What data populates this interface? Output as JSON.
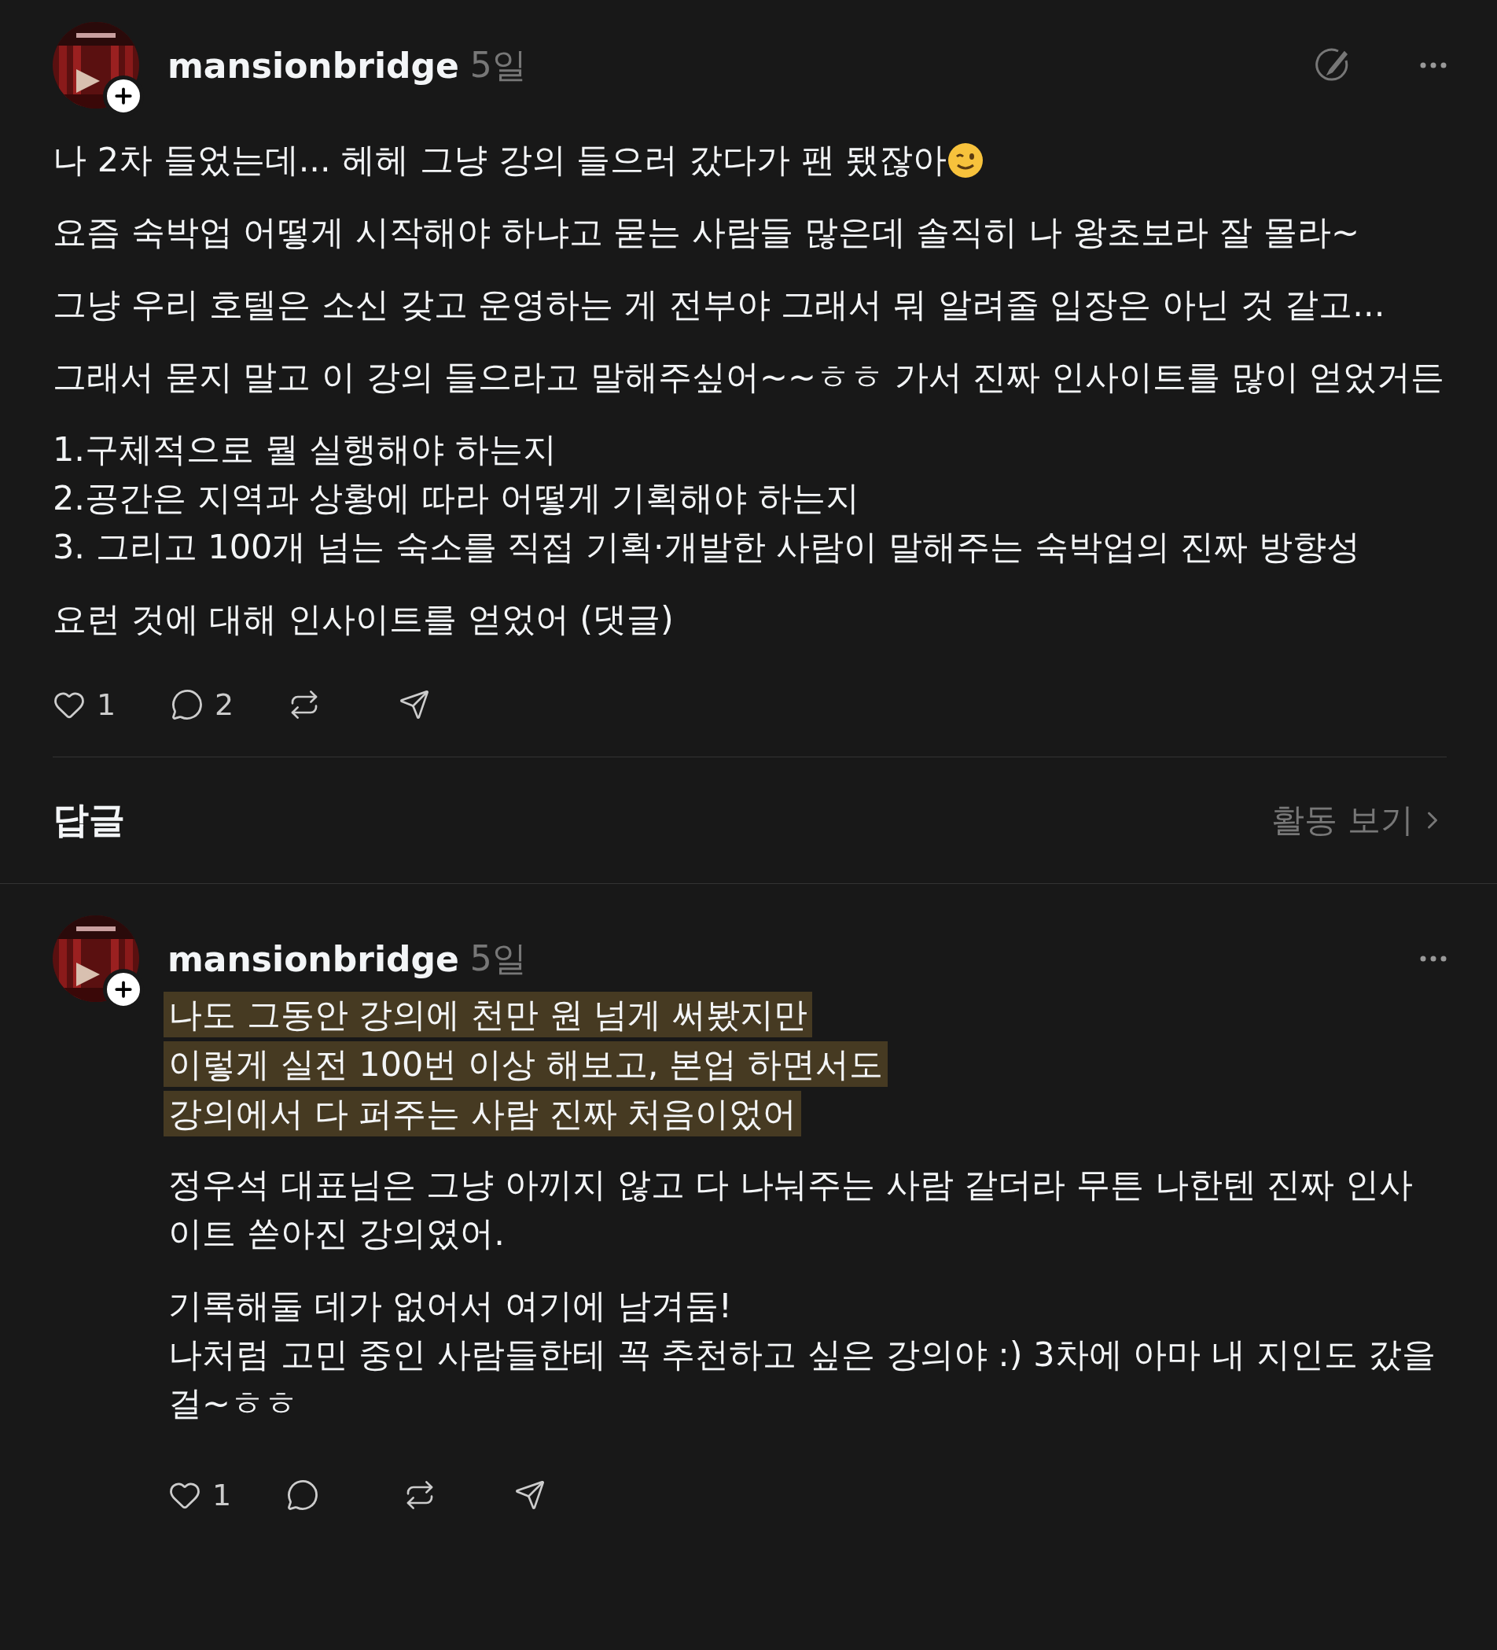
{
  "post": {
    "author": "mansionbridge",
    "time": "5일",
    "following": false,
    "paragraphs": [
      {
        "lines": [
          "나 2차 들었는데... 헤헤 그냥 강의 들으러 갔다가 팬 됐잖아"
        ],
        "emoji": true
      },
      {
        "lines": [
          "요즘 숙박업 어떻게 시작해야 하냐고 묻는 사람들 많은데 솔직히 나 왕초보라 잘 몰라~"
        ],
        "emoji": false
      },
      {
        "lines": [
          "그냥 우리 호텔은 소신 갖고 운영하는 게 전부야 그래서 뭐 알려줄 입장은 아닌 것 같고..."
        ],
        "emoji": false
      },
      {
        "lines": [
          "그래서 묻지 말고 이 강의 들으라고 말해주싶어~~ㅎㅎ 가서 진짜 인사이트를 많이 얻었거든"
        ],
        "emoji": false
      },
      {
        "lines": [
          "1.구체적으로 뭘 실행해야 하는지",
          "2.공간은 지역과 상황에 따라 어떻게 기획해야 하는지",
          "3. 그리고 100개 넘는 숙소를 직접 기획·개발한 사람이 말해주는 숙박업의 진짜 방향성"
        ],
        "emoji": false
      },
      {
        "lines": [
          "요런 것에 대해 인사이트를 얻었어 (댓글)"
        ],
        "emoji": false
      }
    ],
    "likes": "1",
    "replies": "2"
  },
  "replies_header": {
    "title": "답글",
    "activity_link": "활동 보기"
  },
  "reply": {
    "author": "mansionbridge",
    "time": "5일",
    "following": false,
    "highlighted_lines": [
      "나도 그동안 강의에 천만 원 넘게 써봤지만",
      "이렇게 실전 100번 이상 해보고, 본업 하면서도",
      "강의에서 다 퍼주는 사람 진짜 처음이었어 "
    ],
    "paragraphs": [
      {
        "lines": [
          "정우석 대표님은 그냥 아끼지 않고 다 나눠주는 사람 같더라 무튼 나한텐 진짜 인사이트 쏟아진 강의였어."
        ]
      },
      {
        "lines": [
          "기록해둘 데가 없어서 여기에 남겨둠!",
          "나처럼 고민 중인 사람들한테 꼭 추천하고 싶은 강의야 :) 3차에 아마 내 지인도 갔을걸~ㅎㅎ"
        ]
      }
    ],
    "likes": "1"
  }
}
